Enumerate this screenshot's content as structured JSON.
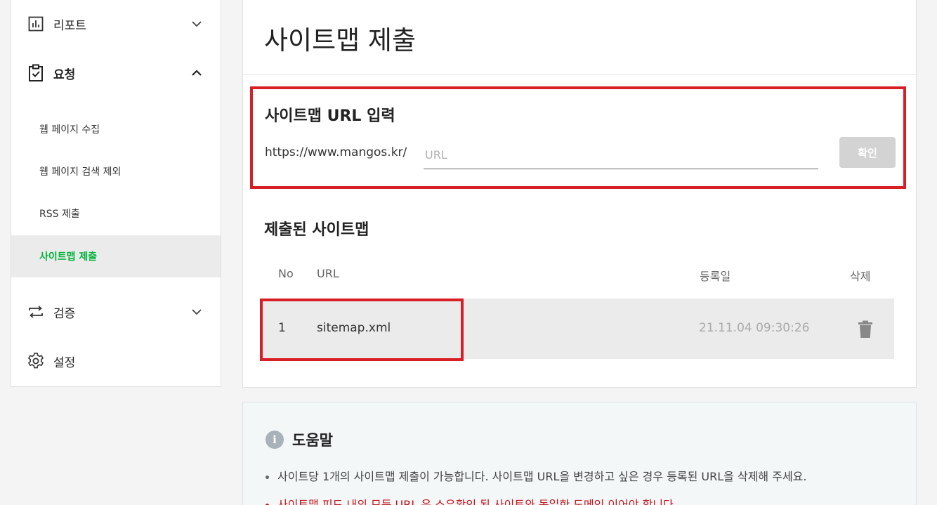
{
  "sidebar": {
    "report": {
      "label": "리포트",
      "icon": "bar-chart-icon"
    },
    "request": {
      "label": "요청",
      "icon": "clipboard-check-icon"
    },
    "request_items": [
      {
        "label": "웹 페이지 수집"
      },
      {
        "label": "웹 페이지 검색 제외"
      },
      {
        "label": "RSS 제출"
      },
      {
        "label": "사이트맵 제출",
        "active": true
      }
    ],
    "verify": {
      "label": "검증",
      "icon": "repeat-arrows-icon"
    },
    "settings": {
      "label": "설정",
      "icon": "gear-icon"
    }
  },
  "main": {
    "title": "사이트맵 제출",
    "input_section": {
      "title": "사이트맵 URL 입력",
      "prefix": "https://www.mangos.kr/",
      "placeholder": "URL",
      "value": "",
      "confirm_label": "확인"
    },
    "submitted": {
      "title": "제출된 사이트맵",
      "headers": {
        "no": "No",
        "url": "URL",
        "date": "등록일",
        "delete": "삭제"
      },
      "rows": [
        {
          "no": "1",
          "url": "sitemap.xml",
          "date": "21.11.04 09:30:26"
        }
      ]
    }
  },
  "help": {
    "icon": "info-icon",
    "icon_glyph": "i",
    "title": "도움말",
    "items": [
      "사이트당 1개의 사이트맵 제출이 가능합니다. 사이트맵 URL을 변경하고 싶은 경우 등록된 URL을 삭제해 주세요.",
      "사이트맵 피드 내의 모든 URL 은 소유확인 된 사이트와 동일한 도메인 이어야 합니다."
    ]
  },
  "colors": {
    "accent_green": "#03b43a",
    "highlight_red": "#d81f26",
    "warning_red": "#c5161d"
  }
}
